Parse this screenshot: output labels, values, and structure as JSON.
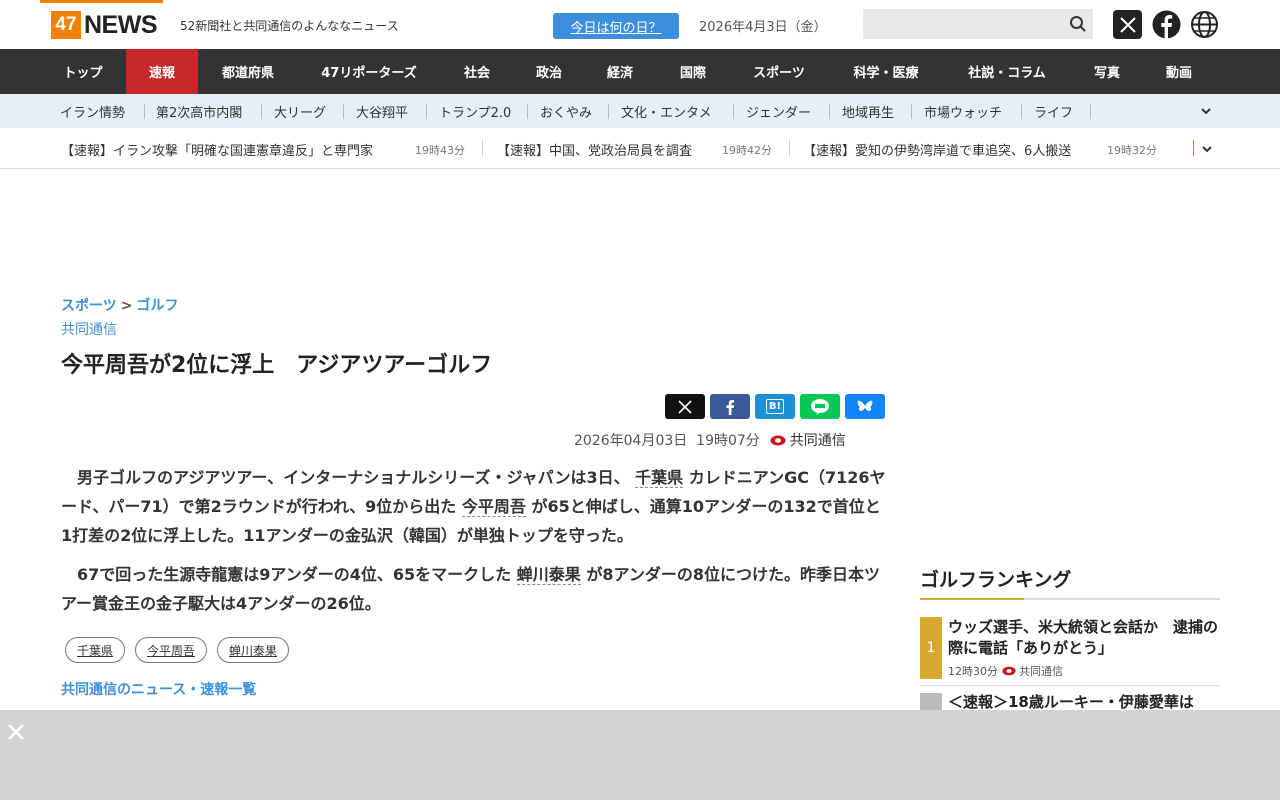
{
  "header": {
    "logo_num": "47",
    "logo_word": "NEWS",
    "tagline": "52新聞社と共同通信のよんななニュース",
    "today_button": "今日は何の日？",
    "date": "2026年4月3日（金）",
    "search_placeholder": ""
  },
  "mainnav": [
    "トップ",
    "速報",
    "都道府県",
    "47リポーターズ",
    "社会",
    "政治",
    "経済",
    "国際",
    "スポーツ",
    "科学・医療",
    "社説・コラム",
    "写真",
    "動画"
  ],
  "mainnav_active": "速報",
  "subnav": [
    "イラン情勢",
    "第2次高市内閣",
    "大リーグ",
    "大谷翔平",
    "トランプ2.0",
    "おくやみ",
    "文化・エンタメ",
    "ジェンダー",
    "地域再生",
    "市場ウォッチ",
    "ライフ"
  ],
  "ticker": [
    {
      "text": "【速報】イラン攻撃「明確な国連憲章違反」と専門家",
      "time": "19時43分"
    },
    {
      "text": "【速報】中国、党政治局員を調査",
      "time": "19時42分"
    },
    {
      "text": "【速報】愛知の伊勢湾岸道で車追突、6人搬送",
      "time": "19時32分"
    }
  ],
  "article": {
    "breadcrumb_1": "スポーツ",
    "breadcrumb_sep": ">",
    "breadcrumb_2": "ゴルフ",
    "source_top": "共同通信",
    "title": "今平周吾が2位に浮上　アジアツアーゴルフ",
    "share": {
      "hatena": "B!"
    },
    "datetime": "2026年04月03日  19時07分",
    "source": "共同通信",
    "p1_a": "　男子ゴルフのアジアツアー、インターナショナルシリーズ・ジャパンは3日、",
    "p1_kw1": "千葉県",
    "p1_b": "カレドニアンGC（7126ヤード、パー71）で第2ラウンドが行われ、9位から出た",
    "p1_kw2": "今平周吾",
    "p1_c": "が65と伸ばし、通算10アンダーの132で首位と1打差の2位に浮上した。11アンダーの金弘沢（韓国）が単独トップを守った。",
    "p2_a": "　67で回った生源寺龍憲は9アンダーの4位、65をマークした",
    "p2_kw": "蝉川泰果",
    "p2_b": "が8アンダーの8位につけた。昨季日本ツアー賞金王の金子駆大は4アンダーの26位。",
    "tags": [
      "千葉県",
      "今平周吾",
      "蝉川泰果"
    ],
    "list_link": "共同通信のニュース・速報一覧"
  },
  "ranking": {
    "title": "ゴルフランキング",
    "items": [
      {
        "rank": "1",
        "text": "ウッズ選手、米大統領と会話か　逮捕の際に電話「ありがとう」",
        "time": "12時30分",
        "source": "共同通信"
      },
      {
        "rank": "",
        "text": "＜速報＞18歳ルーキー・伊藤愛華は"
      }
    ]
  },
  "colors": {
    "accent": "#f08200",
    "link": "#3b8fdc",
    "active": "#c6282b",
    "rank": "#d9a82e"
  }
}
